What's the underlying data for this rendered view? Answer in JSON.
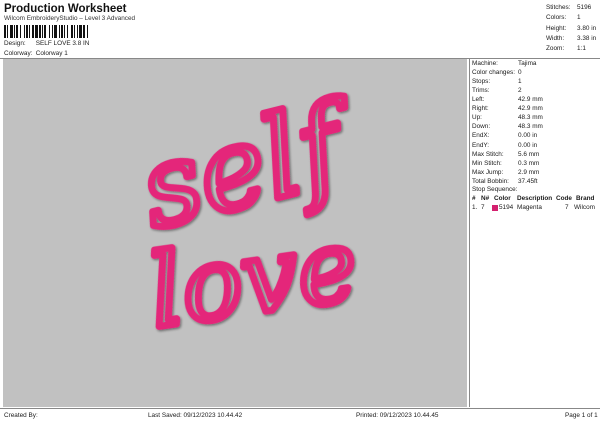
{
  "header": {
    "title": "Production Worksheet",
    "subtitle": "Wilcom EmbroideryStudio – Level 3 Advanced",
    "design_label": "Design:",
    "design_value": "SELF LOVE 3.8 IN",
    "colorway_label": "Colorway:",
    "colorway_value": "Colorway 1"
  },
  "top_stats": [
    {
      "label": "Stitches:",
      "value": "5196"
    },
    {
      "label": "Colors:",
      "value": "1"
    },
    {
      "label": "Height:",
      "value": "3.80 in"
    },
    {
      "label": "Width:",
      "value": "3.38 in"
    },
    {
      "label": "Zoom:",
      "value": "1:1"
    }
  ],
  "design": {
    "line1": "self",
    "line2": "love",
    "thread_color": "#e4287a",
    "background_color": "#c1c1c1"
  },
  "properties": [
    {
      "label": "Machine:",
      "value": "Tajima"
    },
    {
      "label": "Color changes:",
      "value": "0"
    },
    {
      "label": "Stops:",
      "value": "1"
    },
    {
      "label": "Trims:",
      "value": "2"
    },
    {
      "label": "Left:",
      "value": "42.9 mm"
    },
    {
      "label": "Right:",
      "value": "42.9 mm"
    },
    {
      "label": "Up:",
      "value": "48.3 mm"
    },
    {
      "label": "Down:",
      "value": "48.3 mm"
    },
    {
      "label": "EndX:",
      "value": "0.00 in"
    },
    {
      "label": "EndY:",
      "value": "0.00 in"
    },
    {
      "label": "Max Stitch:",
      "value": "5.6 mm"
    },
    {
      "label": "Min Stitch:",
      "value": "0.3 mm"
    },
    {
      "label": "Max Jump:",
      "value": "2.9 mm"
    },
    {
      "label": "Total Bobbin:",
      "value": "37.45ft"
    }
  ],
  "stop_sequence": {
    "title": "Stop Sequence:",
    "headers": {
      "num": "#",
      "n": "N#",
      "color": "Color",
      "description": "Description",
      "code": "Code",
      "brand": "Brand"
    },
    "rows": [
      {
        "num": "1.",
        "n": "7",
        "color_hex": "#d4206f",
        "color_code": "5194",
        "description": "Magenta",
        "code": "7",
        "brand": "Wilcom"
      }
    ]
  },
  "footer": {
    "created_by": "Created By:",
    "last_saved": "Last Saved: 09/12/2023 10.44.42",
    "printed": "Printed: 09/12/2023 10.44.45",
    "page": "Page 1 of 1"
  }
}
